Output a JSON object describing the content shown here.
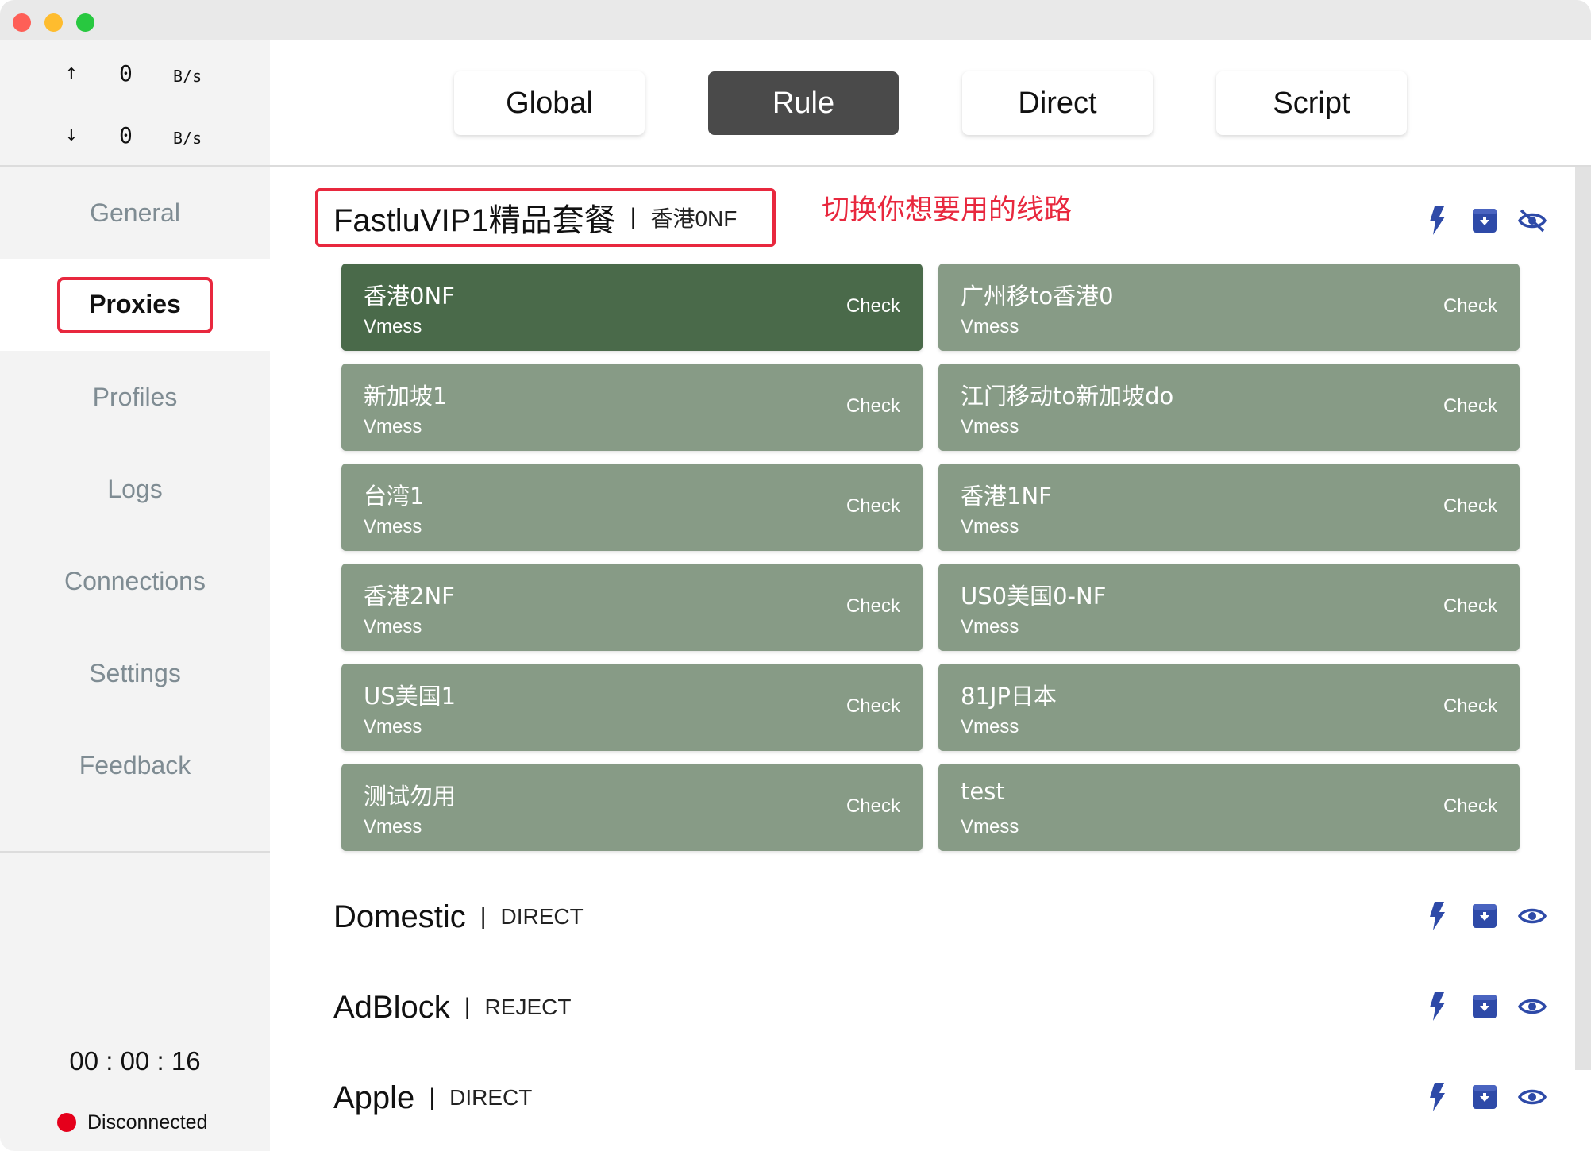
{
  "window": {
    "title": ""
  },
  "traffic": {
    "up": {
      "arrow": "↑",
      "value": "0",
      "unit": "B/s"
    },
    "down": {
      "arrow": "↓",
      "value": "0",
      "unit": "B/s"
    }
  },
  "nav": {
    "items": [
      {
        "label": "General"
      },
      {
        "label": "Proxies"
      },
      {
        "label": "Profiles"
      },
      {
        "label": "Logs"
      },
      {
        "label": "Connections"
      },
      {
        "label": "Settings"
      },
      {
        "label": "Feedback"
      }
    ],
    "active": "Proxies"
  },
  "status": {
    "timer": "00 : 00 : 16",
    "connection": "Disconnected",
    "connection_color": "#e5001b"
  },
  "modes": {
    "buttons": [
      {
        "label": "Global"
      },
      {
        "label": "Rule"
      },
      {
        "label": "Direct"
      },
      {
        "label": "Script"
      }
    ],
    "active": "Rule"
  },
  "annotation": "切换你想要用的线路",
  "groups": [
    {
      "name": "FastluVIP1精品套餐",
      "now": "香港0NF",
      "icons": [
        "latency-test-icon",
        "locate-icon",
        "eye-off-icon"
      ]
    },
    {
      "name": "Domestic",
      "now": "DIRECT",
      "icons": [
        "latency-test-icon",
        "locate-icon",
        "eye-icon"
      ]
    },
    {
      "name": "AdBlock",
      "now": "REJECT",
      "icons": [
        "latency-test-icon",
        "locate-icon",
        "eye-icon"
      ]
    },
    {
      "name": "Apple",
      "now": "DIRECT",
      "icons": [
        "latency-test-icon",
        "locate-icon",
        "eye-icon"
      ]
    }
  ],
  "proxies": [
    {
      "name": "香港0NF",
      "type": "Vmess",
      "action": "Check",
      "selected": true
    },
    {
      "name": "广州移to香港0",
      "type": "Vmess",
      "action": "Check",
      "selected": false
    },
    {
      "name": "新加坡1",
      "type": "Vmess",
      "action": "Check",
      "selected": false
    },
    {
      "name": "江门移动to新加坡do",
      "type": "Vmess",
      "action": "Check",
      "selected": false
    },
    {
      "name": "台湾1",
      "type": "Vmess",
      "action": "Check",
      "selected": false
    },
    {
      "name": "香港1NF",
      "type": "Vmess",
      "action": "Check",
      "selected": false
    },
    {
      "name": "香港2NF",
      "type": "Vmess",
      "action": "Check",
      "selected": false
    },
    {
      "name": "US0美国0-NF",
      "type": "Vmess",
      "action": "Check",
      "selected": false
    },
    {
      "name": "US美国1",
      "type": "Vmess",
      "action": "Check",
      "selected": false
    },
    {
      "name": "81JP日本",
      "type": "Vmess",
      "action": "Check",
      "selected": false
    },
    {
      "name": "测试勿用",
      "type": "Vmess",
      "action": "Check",
      "selected": false
    },
    {
      "name": "test",
      "type": "Vmess",
      "action": "Check",
      "selected": false
    }
  ],
  "colors": {
    "accent_icon": "#2e4aa8",
    "selected_card": "#4a6a4a",
    "card": "#879b86",
    "highlight": "#e8283e"
  }
}
